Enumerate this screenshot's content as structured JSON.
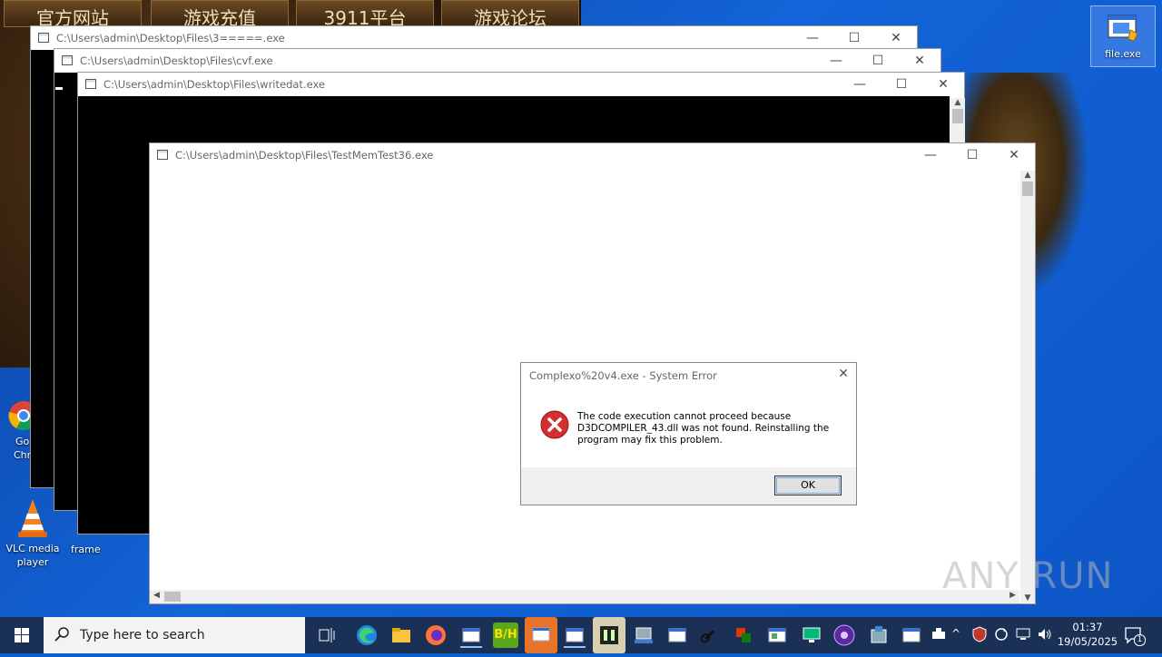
{
  "desktop": {
    "background_nav": [
      "官方网站",
      "游戏充值",
      "3911平台",
      "游戏论坛"
    ],
    "icons": [
      {
        "label": "file.exe",
        "name": "file-exe-icon"
      },
      {
        "label": "Go",
        "label2": "Chr",
        "name": "google-chrome-icon"
      },
      {
        "label": "VLC media",
        "label2": "player",
        "name": "vlc-icon"
      },
      {
        "label": "frame",
        "name": "frame-icon"
      }
    ]
  },
  "windows": [
    {
      "title": "C:\\Users\\admin\\Desktop\\Files\\3=====.exe"
    },
    {
      "title": "C:\\Users\\admin\\Desktop\\Files\\cvf.exe"
    },
    {
      "title": "C:\\Users\\admin\\Desktop\\Files\\writedat.exe"
    },
    {
      "title": "C:\\Users\\admin\\Desktop\\Files\\TestMemTest36.exe"
    }
  ],
  "window_controls": {
    "minimize": "—",
    "maximize": "☐",
    "close": "✕"
  },
  "dialog": {
    "title": "Complexo%20v4.exe - System Error",
    "message": "The code execution cannot proceed because D3DCOMPILER_43.dll was not found. Reinstalling the program may fix this problem.",
    "ok_label": "OK",
    "close": "✕"
  },
  "taskbar": {
    "search_placeholder": "Type here to search",
    "time": "01:37",
    "date": "19/05/2025",
    "notification_count": "1"
  },
  "watermark": "ANY RUN",
  "colors": {
    "taskbar": "#1a3155",
    "desktop": "#1364d8",
    "error": "#d32f2f"
  }
}
